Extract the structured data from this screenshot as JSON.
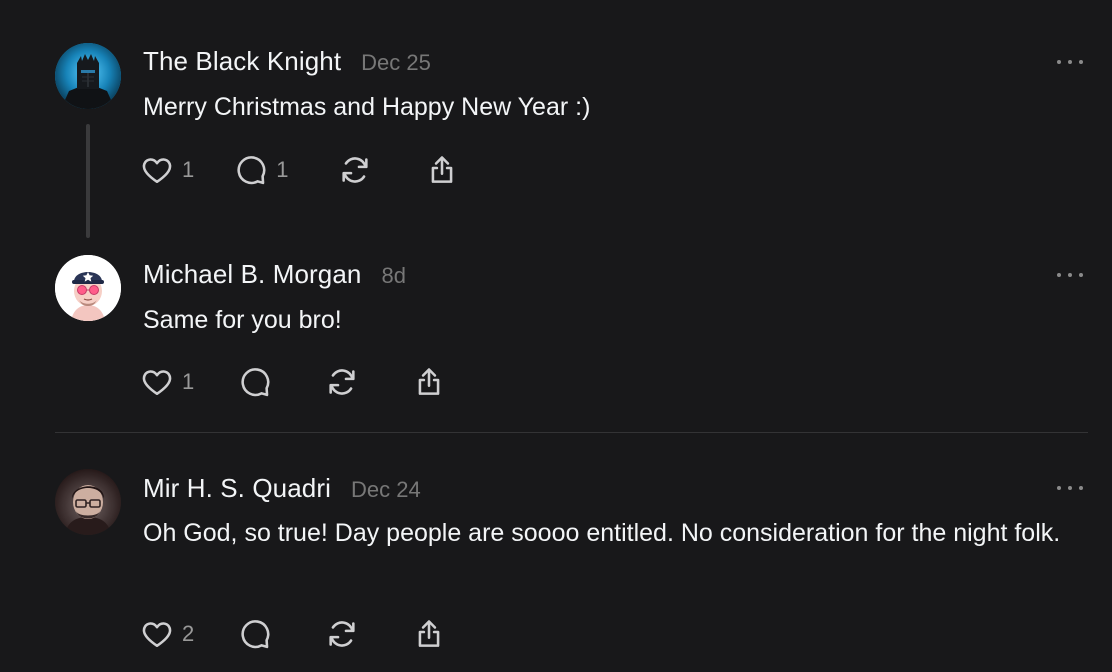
{
  "posts": [
    {
      "author": "The Black Knight",
      "time": "Dec 25",
      "text": "Merry Christmas and Happy New Year :)",
      "likes": "1",
      "replies": "1",
      "avatar_icon": "black-knight-helmet"
    },
    {
      "author": "Michael B. Morgan",
      "time": "8d",
      "text": "Same for you bro!",
      "likes": "1",
      "replies": "",
      "avatar_icon": "cartoon-man-cap-sunglasses"
    },
    {
      "author": "Mir H. S. Quadri",
      "time": "Dec 24",
      "text": "Oh God, so true! Day people are soooo entitled. No consideration for the night folk.",
      "likes": "2",
      "replies": "",
      "avatar_icon": "man-with-glasses-photo"
    }
  ],
  "colors": {
    "background": "#18181a",
    "text_primary": "#f3f5f7",
    "text_secondary": "#777777",
    "thread_line": "#3a3a3c",
    "divider": "#333335"
  },
  "icons": {
    "like": "heart-icon",
    "reply": "comment-icon",
    "repost": "repost-icon",
    "share": "share-icon",
    "more": "more-icon"
  }
}
